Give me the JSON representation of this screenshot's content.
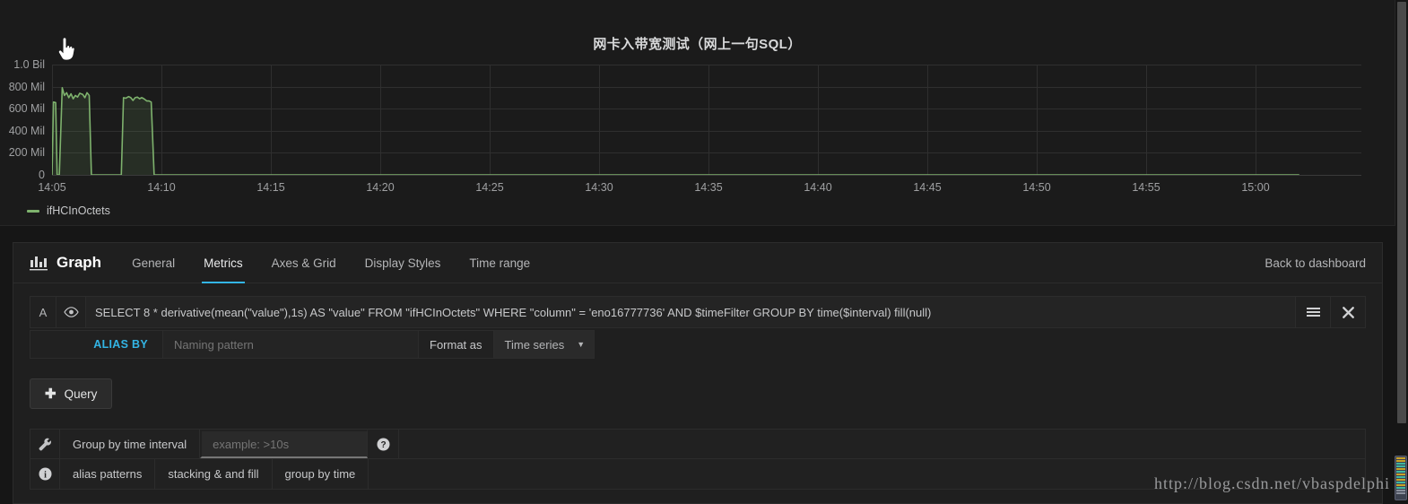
{
  "panel": {
    "title": "网卡入带宽测试（网上一句SQL）",
    "cursor": "pointing-hand-cursor"
  },
  "chart_data": {
    "type": "area",
    "title": "网卡入带宽测试（网上一句SQL）",
    "xlabel": "",
    "ylabel": "",
    "grid": true,
    "legend_position": "bottom-left",
    "series_color": "#7eb26d",
    "ylim": [
      0,
      1000000000
    ],
    "yticks": [
      0,
      200000000,
      400000000,
      600000000,
      800000000,
      1000000000
    ],
    "ytick_labels": [
      "0",
      "200 Mil",
      "400 Mil",
      "600 Mil",
      "800 Mil",
      "1.0 Bil"
    ],
    "xtick_labels": [
      "14:05",
      "14:10",
      "14:15",
      "14:20",
      "14:25",
      "14:30",
      "14:35",
      "14:40",
      "14:45",
      "14:50",
      "14:55",
      "15:00"
    ],
    "series": [
      {
        "name": "ifHCInOctets",
        "x": [
          "14:05:00",
          "14:05:04",
          "14:05:10",
          "14:05:14",
          "14:05:20",
          "14:05:28",
          "14:05:34",
          "14:05:40",
          "14:05:46",
          "14:05:52",
          "14:05:58",
          "14:06:04",
          "14:06:10",
          "14:06:16",
          "14:06:24",
          "14:06:30",
          "14:06:36",
          "14:06:42",
          "14:06:48",
          "14:07:00",
          "14:07:30",
          "14:08:10",
          "14:08:16",
          "14:08:22",
          "14:08:30",
          "14:08:36",
          "14:08:42",
          "14:08:48",
          "14:08:54",
          "14:09:00",
          "14:09:06",
          "14:09:12",
          "14:09:20",
          "14:09:26",
          "14:09:32",
          "14:09:40",
          "14:10:00",
          "15:02:00"
        ],
        "values": [
          0,
          660000000,
          655000000,
          0,
          0,
          790000000,
          720000000,
          745000000,
          700000000,
          735000000,
          690000000,
          720000000,
          705000000,
          740000000,
          730000000,
          700000000,
          745000000,
          720000000,
          0,
          0,
          0,
          0,
          700000000,
          695000000,
          710000000,
          700000000,
          675000000,
          700000000,
          705000000,
          690000000,
          700000000,
          690000000,
          670000000,
          670000000,
          660000000,
          0,
          0,
          0
        ]
      }
    ],
    "legend": [
      "ifHCInOctets"
    ]
  },
  "editor": {
    "panel_type_label": "Graph",
    "panel_type_icon": "bar-chart-icon",
    "back_to_dashboard": "Back to dashboard",
    "tabs": [
      {
        "label": "General",
        "active": false
      },
      {
        "label": "Metrics",
        "active": true
      },
      {
        "label": "Axes & Grid",
        "active": false
      },
      {
        "label": "Display Styles",
        "active": false
      },
      {
        "label": "Time range",
        "active": false
      }
    ]
  },
  "query": {
    "letter": "A",
    "eye_icon": "eye-icon",
    "sql": "SELECT 8 * derivative(mean(\"value\"),1s) AS \"value\" FROM \"ifHCInOctets\" WHERE \"column\" = 'eno16777736' AND $timeFilter GROUP BY time($interval) fill(null)",
    "menu_icon": "hamburger-menu-icon",
    "remove_icon": "close-icon",
    "alias_by_label": "ALIAS BY",
    "alias_placeholder": "Naming pattern",
    "alias_value": "",
    "format_as_label": "Format as",
    "format_as_value": "Time series",
    "add_query_label": "Query",
    "add_query_icon": "plus-icon"
  },
  "options": {
    "wrench_icon": "wrench-icon",
    "group_by_label": "Group by time interval",
    "group_by_placeholder": "example: >10s",
    "group_by_value": "",
    "help_icon": "question-circle-icon",
    "info_icon": "info-circle-icon",
    "links": [
      "alias patterns",
      "stacking & and fill",
      "group by time"
    ]
  },
  "watermark": {
    "text": "http://blog.csdn.net/vbaspdelphi"
  },
  "colors": {
    "accent": "#33b5e5",
    "series": "#7eb26d",
    "panel_bg": "#1b1b1b",
    "editor_bg": "#1f1f1f"
  }
}
